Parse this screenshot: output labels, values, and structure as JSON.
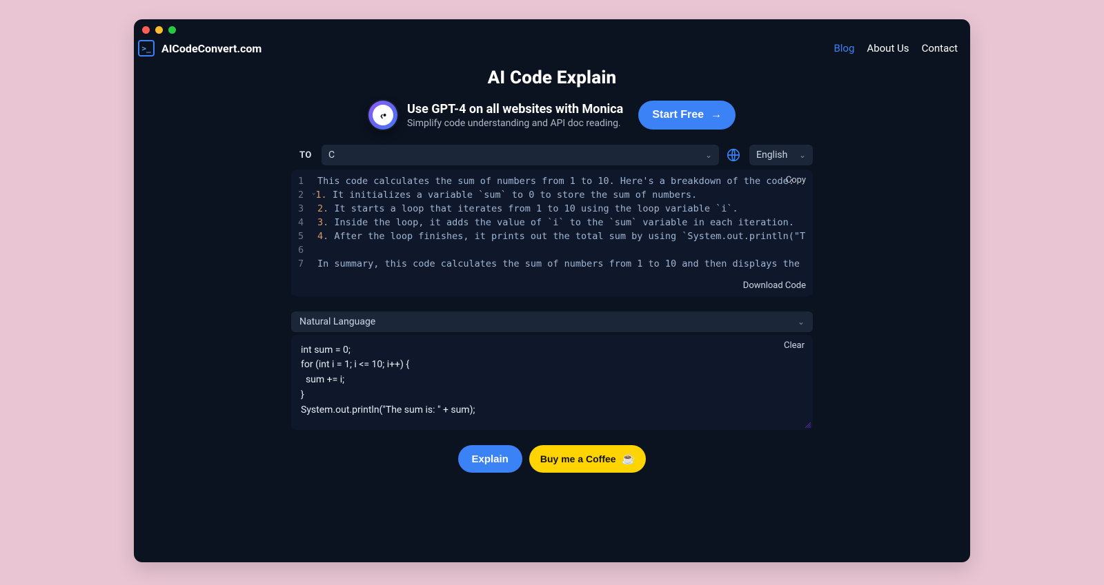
{
  "brand": {
    "name": "AICodeConvert.com",
    "badge": ">_"
  },
  "nav": {
    "blog": "Blog",
    "about": "About Us",
    "contact": "Contact"
  },
  "title": "AI Code Explain",
  "promo": {
    "headline": "Use GPT-4 on all websites with Monica",
    "sub": "Simplify code understanding and API doc reading.",
    "cta": "Start Free",
    "cta_arrow": "→",
    "avatar_face": "‹•"
  },
  "to_label": "TO",
  "to_select_value": "C",
  "lang_select_value": "English",
  "copy_label": "Copy",
  "download_label": "Download Code",
  "nat_lang_label": "Natural Language",
  "clear_label": "Clear",
  "explain_btn": "Explain",
  "coffee_btn": "Buy me a Coffee",
  "coffee_emoji": "☕",
  "code_lines": [
    {
      "n": 1,
      "marker": "",
      "text": "This code calculates the sum of numbers from 1 to 10. Here's a breakdown of the code:"
    },
    {
      "n": 2,
      "marker": "1.",
      "fold": true,
      "text": "It initializes a variable `sum` to 0 to store the sum of numbers."
    },
    {
      "n": 3,
      "marker": "2.",
      "text": "It starts a loop that iterates from 1 to 10 using the loop variable `i`."
    },
    {
      "n": 4,
      "marker": "3.",
      "text": "Inside the loop, it adds the value of `i` to the `sum` variable in each iteration."
    },
    {
      "n": 5,
      "marker": "4.",
      "text": "After the loop finishes, it prints out the total sum by using `System.out.println(\"The sum is: \" + s"
    },
    {
      "n": 6,
      "marker": "",
      "text": ""
    },
    {
      "n": 7,
      "marker": "",
      "text": "In summary, this code calculates the sum of numbers from 1 to 10 and then displays the result using the"
    }
  ],
  "input_code": "int sum = 0;\nfor (int i = 1; i <= 10; i++) {\n  sum += i;\n}\nSystem.out.println(\"The sum is: \" + sum);"
}
